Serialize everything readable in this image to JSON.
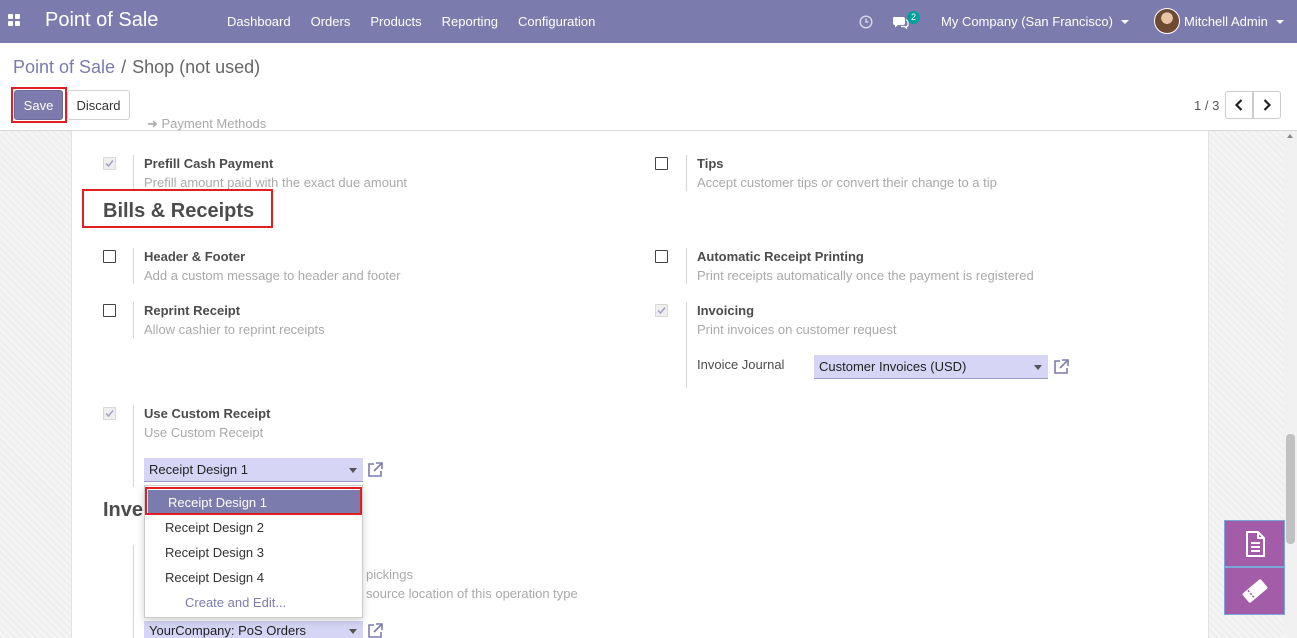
{
  "navbar": {
    "brand": "Point of Sale",
    "menu": [
      "Dashboard",
      "Orders",
      "Products",
      "Reporting",
      "Configuration"
    ],
    "chat_count": "2",
    "company": "My Company (San Francisco)",
    "user": "Mitchell Admin"
  },
  "breadcrumb": {
    "parent": "Point of Sale",
    "separator": "/",
    "current": "Shop (not used)"
  },
  "actions": {
    "save": "Save",
    "discard": "Discard"
  },
  "pager": {
    "label": "1 / 3"
  },
  "settings": {
    "partial_top": "Payment Methods",
    "prefill": {
      "title": "Prefill Cash Payment",
      "desc": "Prefill amount paid with the exact due amount",
      "checked": true
    },
    "tips": {
      "title": "Tips",
      "desc": "Accept customer tips or convert their change to a tip",
      "checked": false
    },
    "bills_section": "Bills & Receipts",
    "header_footer": {
      "title": "Header & Footer",
      "desc": "Add a custom message to header and footer",
      "checked": false
    },
    "auto_print": {
      "title": "Automatic Receipt Printing",
      "desc": "Print receipts automatically once the payment is registered",
      "checked": false
    },
    "reprint": {
      "title": "Reprint Receipt",
      "desc": "Allow cashier to reprint receipts",
      "checked": false
    },
    "invoicing": {
      "title": "Invoicing",
      "desc": "Print invoices on customer request",
      "checked": true
    },
    "invoice_journal": {
      "label": "Invoice Journal",
      "value": "Customer Invoices (USD)"
    },
    "custom_receipt": {
      "title": "Use Custom Receipt",
      "desc": "Use Custom Receipt",
      "checked": true,
      "value": "Receipt Design 1"
    },
    "inventory_section_partial": "Inve",
    "hidden_desc_1": "pickings",
    "hidden_desc_2": "source location of this operation type",
    "operation_type_value": "YourCompany: PoS Orders"
  },
  "dropdown": {
    "options": [
      "Receipt Design 1",
      "Receipt Design 2",
      "Receipt Design 3",
      "Receipt Design 4"
    ],
    "create_edit": "Create and Edit..."
  },
  "colors": {
    "brand": "#7c7bad",
    "highlight": "#e02020",
    "fab": "#a35ca8"
  }
}
